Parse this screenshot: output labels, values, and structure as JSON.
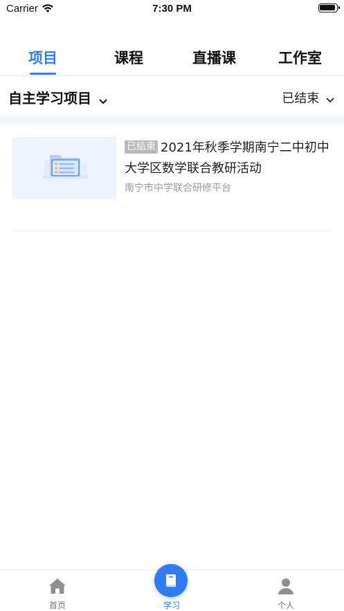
{
  "status_bar": {
    "carrier": "Carrier",
    "time": "7:30 PM"
  },
  "tabs": [
    {
      "label": "项目",
      "active": true
    },
    {
      "label": "课程",
      "active": false
    },
    {
      "label": "直播课",
      "active": false
    },
    {
      "label": "工作室",
      "active": false
    }
  ],
  "filter": {
    "category": "自主学习项目",
    "status": "已结束"
  },
  "projects": [
    {
      "status_tag": "已结束",
      "title": "2021年秋季学期南宁二中初中大学区数学联合教研活动",
      "org": "南宁市中学联合研修平台"
    }
  ],
  "bottom_nav": [
    {
      "label": "首页",
      "icon": "home-icon",
      "active": false
    },
    {
      "label": "学习",
      "icon": "book-icon",
      "active": true
    },
    {
      "label": "个人",
      "icon": "person-icon",
      "active": false
    }
  ],
  "colors": {
    "accent": "#2f7cf6",
    "tag_bg": "#b9b9b9",
    "band": "#f3f4f7"
  }
}
